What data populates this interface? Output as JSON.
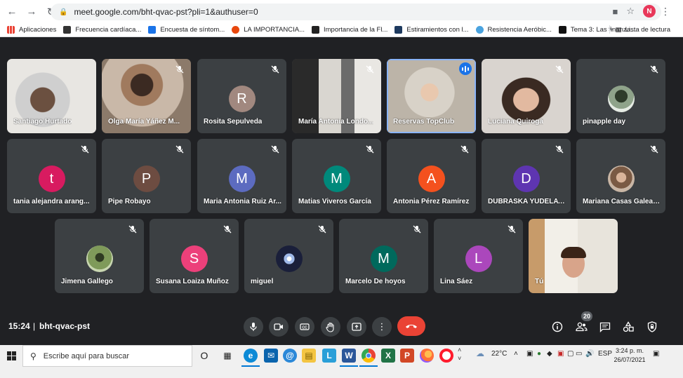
{
  "browser": {
    "url": "meet.google.com/bht-qvac-pst?pli=1&authuser=0",
    "profile_initial": "N",
    "bookmarks": [
      {
        "label": "Aplicaciones",
        "color": "#ea4335"
      },
      {
        "label": "Frecuencia cardíaca...",
        "color": "#333333"
      },
      {
        "label": "Encuesta de síntom...",
        "color": "#1a73e8"
      },
      {
        "label": "LA IMPORTANCIA...",
        "color": "#e8470d"
      },
      {
        "label": "Importancia de la Fl...",
        "color": "#222222"
      },
      {
        "label": "Estiramientos con l...",
        "color": "#1e3a5f"
      },
      {
        "label": "Resistencia Aeróbic...",
        "color": "#4aa3df"
      },
      {
        "label": "Tema 3: Las finanza...",
        "color": "#111111"
      }
    ],
    "reading_list": "Lista de lectura"
  },
  "participants": [
    {
      "name": "Santiago Hurtado",
      "type": "video",
      "muted": false
    },
    {
      "name": "Olga María Yáñez M...",
      "type": "video",
      "muted": true
    },
    {
      "name": "Rosita Sepulveda",
      "type": "avatar",
      "initial": "R",
      "color": "#a1887f",
      "muted": true
    },
    {
      "name": "María Antonia Londo...",
      "type": "video",
      "muted": true
    },
    {
      "name": "Reservas TopClub",
      "type": "video",
      "muted": false,
      "speaking": true
    },
    {
      "name": "Luciana Quiroga",
      "type": "video",
      "muted": true
    },
    {
      "name": "pinapple day",
      "type": "photo",
      "muted": true
    },
    {
      "name": "tania alejandra arang...",
      "type": "avatar",
      "initial": "t",
      "color": "#d81b60",
      "muted": true
    },
    {
      "name": "Pipe Robayo",
      "type": "avatar",
      "initial": "P",
      "color": "#6d4c41",
      "muted": true
    },
    {
      "name": "Maria Antonia Ruiz Ar...",
      "type": "avatar",
      "initial": "M",
      "color": "#5c6bc0",
      "muted": true
    },
    {
      "name": "Matias Viveros García",
      "type": "avatar",
      "initial": "M",
      "color": "#00897b",
      "muted": true
    },
    {
      "name": "Antonia Pérez Ramírez",
      "type": "avatar",
      "initial": "A",
      "color": "#f4511e",
      "muted": true
    },
    {
      "name": "DUBRASKA YUDELAY ...",
      "type": "avatar",
      "initial": "D",
      "color": "#5e35b1",
      "muted": true
    },
    {
      "name": "Mariana Casas Galeano",
      "type": "photo",
      "muted": true
    },
    {
      "name": "Jimena Gallego",
      "type": "photo",
      "muted": true
    },
    {
      "name": "Susana Loaiza Muñoz",
      "type": "avatar",
      "initial": "S",
      "color": "#ec407a",
      "muted": true
    },
    {
      "name": "miguel",
      "type": "photo",
      "muted": true
    },
    {
      "name": "Marcelo De hoyos",
      "type": "avatar",
      "initial": "M",
      "color": "#00695c",
      "muted": true
    },
    {
      "name": "Lina Sáez",
      "type": "avatar",
      "initial": "L",
      "color": "#ab47bc",
      "muted": true
    },
    {
      "name": "Tú",
      "type": "video",
      "muted": false
    }
  ],
  "controls": {
    "time": "15:24",
    "divider": "|",
    "meeting_code": "bht-qvac-pst",
    "participant_count": "20",
    "hangup_color": "#ea4335"
  },
  "taskbar": {
    "search_placeholder": "Escribe aquí para buscar",
    "temperature": "22°C",
    "language": "ESP",
    "clock_time": "3:24 p. m.",
    "clock_date": "26/07/2021"
  }
}
